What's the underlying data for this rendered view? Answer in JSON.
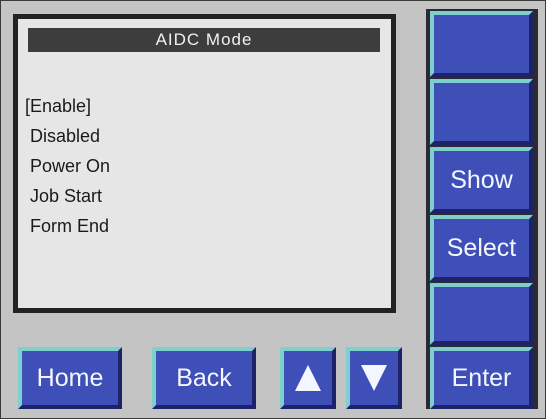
{
  "screen": {
    "title": "AIDC Mode",
    "options": [
      "[Enable]",
      " Disabled",
      " Power On",
      " Job Start",
      " Form End"
    ]
  },
  "side_buttons": [
    "",
    "",
    "Show",
    "Select",
    "",
    "Enter"
  ],
  "bottom_buttons": {
    "home": "Home",
    "back": "Back",
    "up_icon": "arrow-up-icon",
    "down_icon": "arrow-down-icon"
  },
  "colors": {
    "button_face": "#3e4fb7",
    "button_highlight": "#7fd0cc",
    "button_shadow": "#1c2369",
    "panel": "#c4c4c4",
    "screen_bg": "#e6e6e6"
  }
}
